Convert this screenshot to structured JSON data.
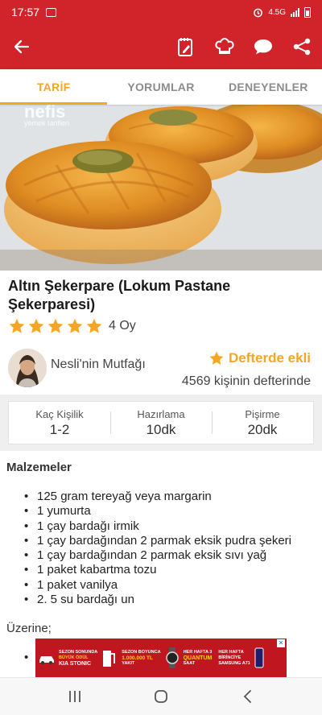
{
  "status": {
    "time": "17:57",
    "network": "4.5G"
  },
  "colors": {
    "brand_red": "#d0232a",
    "accent_orange": "#f5a623"
  },
  "icons": {
    "back": "back-arrow-icon",
    "shopping_list": "notepad-pencil-icon",
    "chef": "chef-hat-icon",
    "comment": "chat-bubble-icon",
    "share": "share-icon"
  },
  "tabs": [
    {
      "label": "TARİF",
      "active": true
    },
    {
      "label": "YORUMLAR",
      "active": false
    },
    {
      "label": "DENEYENLER",
      "active": false
    }
  ],
  "hero": {
    "watermark": "nefis",
    "watermark_sub": "yemek tarifleri"
  },
  "recipe": {
    "title": "Altın Şekerpare (Lokum Pastane Şekerparesi)",
    "rating_stars": 5,
    "rating_count": "4 Oy"
  },
  "author": {
    "name": "Nesli'nin Mutfağı",
    "saved_label": "Defterde ekli",
    "saved_count": "4569 kişinin defterinde"
  },
  "info": [
    {
      "label": "Kaç Kişilik",
      "value": "1-2"
    },
    {
      "label": "Hazırlama",
      "value": "10dk"
    },
    {
      "label": "Pişirme",
      "value": "20dk"
    }
  ],
  "ingredients": {
    "heading": "Malzemeler",
    "items": [
      "125 gram tereyağ veya margarin",
      "1 yumurta",
      "1 çay bardağı irmik",
      "1 çay bardağından 2 parmak eksik pudra şekeri",
      "1 çay bardağından 2 parmak eksik sıvı yağ",
      "1 paket kabartma tozu",
      "1 paket vanilya",
      "2. 5 su bardağı un"
    ],
    "topping_heading": "Üzerine;"
  },
  "ad": {
    "block1": [
      "SEZON SONUNDA",
      "BÜYÜK ÖDÜL",
      "KIA STONIC"
    ],
    "block2": [
      "SEZON BOYUNCA",
      "1.000.000 TL",
      "YAKIT"
    ],
    "block3": [
      "HER HAFTA 3",
      "QUANTUM",
      "SAAT"
    ],
    "block4": [
      "HER HAFTA",
      "BİRİNCİYE",
      "SAMSUNG A71"
    ]
  }
}
